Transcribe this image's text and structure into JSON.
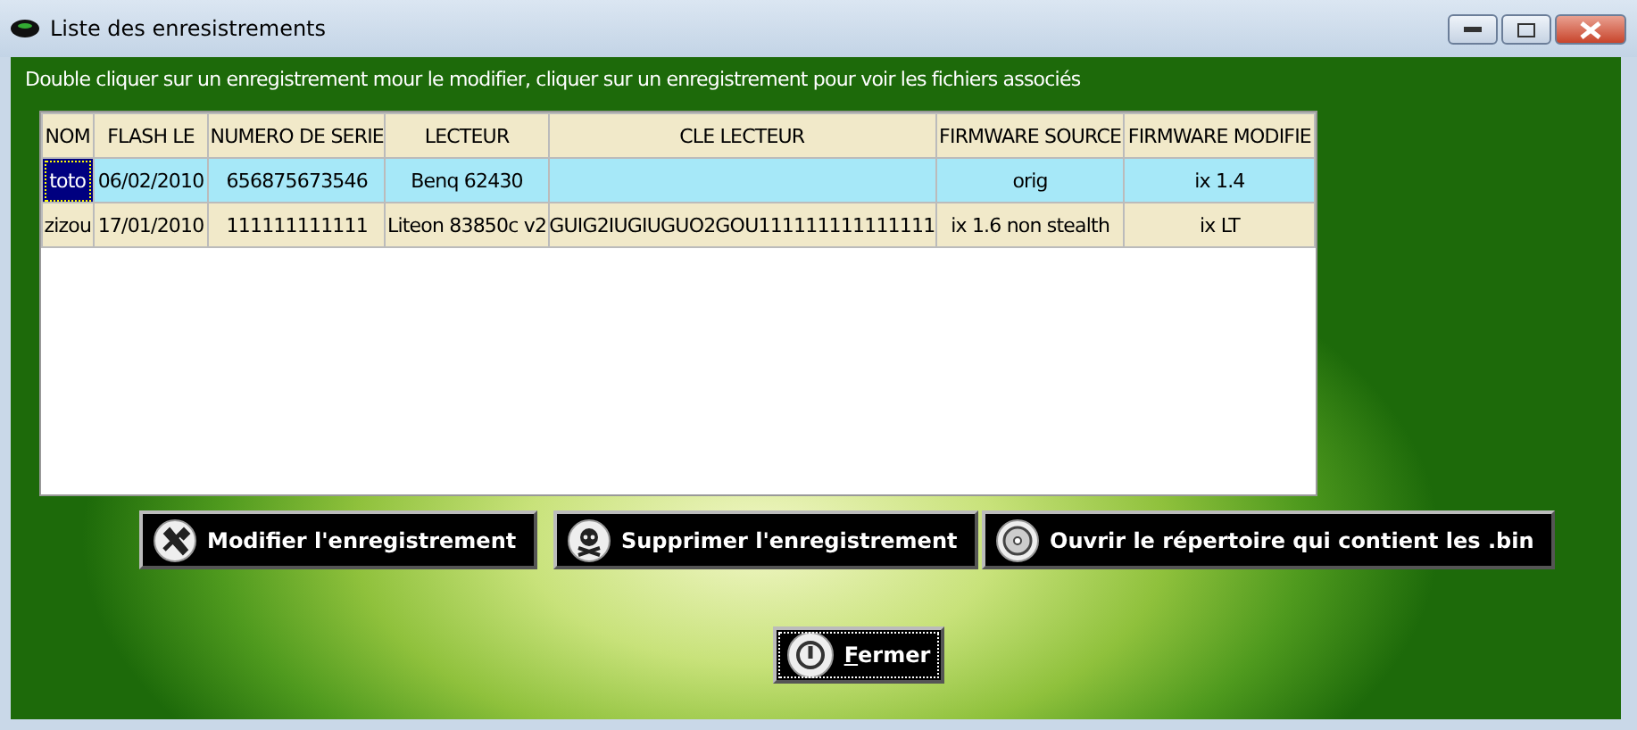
{
  "window": {
    "title": "Liste des enresistrements"
  },
  "instruction": "Double cliquer sur un enregistrement mour le modifier, cliquer sur un enregistrement pour voir les fichiers associés",
  "table": {
    "columns": [
      "NOM",
      "FLASH LE",
      "NUMERO DE SERIE",
      "LECTEUR",
      "CLE LECTEUR",
      "FIRMWARE SOURCE",
      "FIRMWARE MODIFIE"
    ],
    "rows": [
      {
        "selected": true,
        "cells": [
          "toto",
          "06/02/2010",
          "656875673546",
          "Benq 62430",
          "",
          "orig",
          "ix 1.4"
        ]
      },
      {
        "selected": false,
        "cells": [
          "zizou",
          "17/01/2010",
          "111111111111",
          "Liteon 83850c v2",
          "GUIG2IUGIUGUO2GOU111111111111111",
          "ix 1.6 non stealth",
          "ix LT"
        ]
      }
    ]
  },
  "buttons": [
    {
      "kind": "tools",
      "label": "Modifier l'enregistrement"
    },
    {
      "kind": "skull",
      "label": "Supprimer l'enregistrement"
    },
    {
      "kind": "disc",
      "label": "Ouvrir le répertoire qui contient les .bin"
    }
  ],
  "close_button": {
    "kind": "power",
    "label": "Fermer",
    "focused": true
  }
}
